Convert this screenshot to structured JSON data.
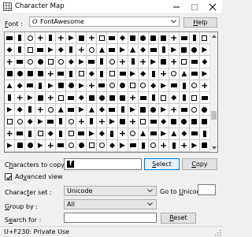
{
  "window": {
    "title": "Character Map"
  },
  "font": {
    "label_prefix": "",
    "label_accel": "F",
    "label_rest": "ont :",
    "selected": "FontAwesome",
    "help_accel": "H",
    "help_rest": "elp"
  },
  "grid": {
    "columns": 20,
    "rows": 10,
    "icon_name": "fontawesome-glyph-icons"
  },
  "copy": {
    "label_accel": "h",
    "label_before": "C",
    "label_after": "aracters to copy :",
    "value_icon": "facebook-icon",
    "select_accel": "S",
    "select_rest": "elect",
    "copy_accel": "C",
    "copy_rest": "opy"
  },
  "advanced": {
    "accel": "v",
    "before": "Ad",
    "after": "anced view",
    "checked": true
  },
  "charset": {
    "label_before": "Charac",
    "label_accel": "t",
    "label_after": "er set :",
    "value": "Unicode",
    "goto_before": "Go to ",
    "goto_accel": "U",
    "goto_after": "nicode :"
  },
  "groupby": {
    "label_before": "",
    "label_accel": "G",
    "label_after": "roup by :",
    "value": "All"
  },
  "search": {
    "label_before": "S",
    "label_accel": "e",
    "label_after": "arch for :",
    "value": "",
    "reset_accel": "R",
    "reset_rest": "eset"
  },
  "status": {
    "text": "U+F230: Private Use"
  }
}
